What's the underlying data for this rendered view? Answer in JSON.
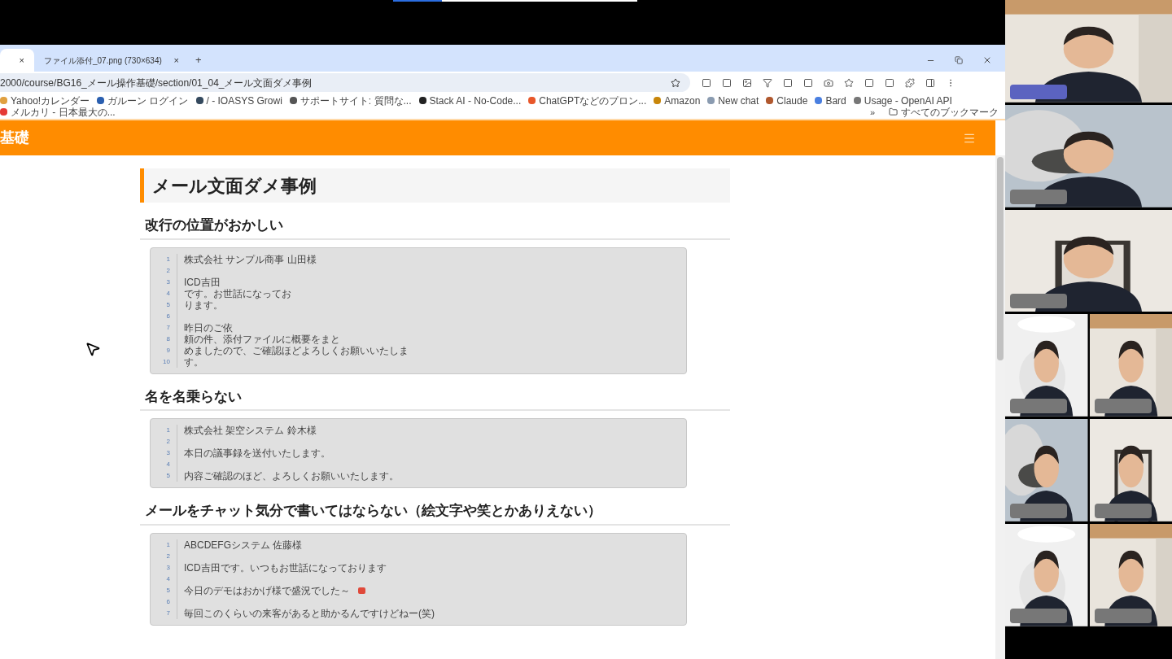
{
  "browser": {
    "tabs": [
      {
        "selected": true,
        "close": "×"
      },
      {
        "label": "ファイル添付_07.png (730×634)",
        "selected": false,
        "close": "×"
      }
    ],
    "new_tab": "+",
    "address": "2000/course/BG16_メール操作基礎/section/01_04_メール文面ダメ事例",
    "bookmarks": [
      {
        "label": "Yahoo!カレンダー",
        "color": "#e0a040"
      },
      {
        "label": "ガルーン ログイン",
        "color": "#2a5fb0"
      },
      {
        "label": "/ - IOASYS Growi",
        "color": "#34495e"
      },
      {
        "label": "サポートサイト: 質問な...",
        "color": "#555555"
      },
      {
        "label": "Stack AI - No-Code...",
        "color": "#222222"
      },
      {
        "label": "ChatGPTなどのプロン...",
        "color": "#e8572a"
      },
      {
        "label": "Amazon",
        "color": "#c8860a"
      },
      {
        "label": "New chat",
        "color": "#8a9bb0"
      },
      {
        "label": "Claude",
        "color": "#b0582e"
      },
      {
        "label": "Bard",
        "color": "#4a7fe0"
      },
      {
        "label": "Usage - OpenAI API",
        "color": "#777777"
      },
      {
        "label": "メルカリ - 日本最大の...",
        "color": "#e53935"
      }
    ],
    "more_bookmarks": "»",
    "all_bookmarks": "すべてのブックマーク"
  },
  "site": {
    "title": "基礎"
  },
  "article": {
    "title": "メール文面ダメ事例",
    "sections": [
      {
        "heading": "改行の位置がおかしい",
        "lines": [
          {
            "no": "1",
            "text": "株式会社 サンプル商事 山田様"
          },
          {
            "no": "2"
          },
          {
            "no": "3",
            "text": "ICD吉田"
          },
          {
            "no": "4",
            "text": "です。お世話になってお"
          },
          {
            "no": "5",
            "text": "ります。"
          },
          {
            "no": "6"
          },
          {
            "no": "7",
            "text": "昨日のご依"
          },
          {
            "no": "8",
            "text": "頼の件、添付ファイルに概要をまと"
          },
          {
            "no": "9",
            "text": "めましたので、ご確認ほどよろしくお願いいたしま"
          },
          {
            "no": "10",
            "text": "す。"
          }
        ]
      },
      {
        "heading": "名を名乗らない",
        "lines": [
          {
            "no": "1",
            "text": "株式会社 架空システム 鈴木様"
          },
          {
            "no": "2"
          },
          {
            "no": "3",
            "text": "本日の議事録を送付いたします。"
          },
          {
            "no": "4"
          },
          {
            "no": "5",
            "text": "内容ご確認のほど、よろしくお願いいたします。"
          }
        ]
      },
      {
        "heading": "メールをチャット気分で書いてはならない（絵文字や笑とかありえない）",
        "lines": [
          {
            "no": "1",
            "text": "ABCDEFGシステム 佐藤様"
          },
          {
            "no": "2"
          },
          {
            "no": "3",
            "text": "ICD吉田です。いつもお世話になっております"
          },
          {
            "no": "4"
          },
          {
            "no": "5",
            "text": "今日のデモはおかげ様で盛況でした～",
            "emoji": true
          },
          {
            "no": "6"
          },
          {
            "no": "7",
            "text": "毎回このくらいの来客があると助かるんですけどねー(笑)"
          }
        ]
      }
    ]
  },
  "participants": [
    {
      "kind": "picture",
      "highlighted": true
    },
    {
      "kind": "picture",
      "highlighted": false
    },
    {
      "kind": "picture",
      "highlighted": false
    },
    {
      "kind": "picture",
      "highlighted": false
    },
    {
      "kind": "picture",
      "highlighted": false
    },
    {
      "kind": "picture",
      "highlighted": false
    },
    {
      "kind": "picture",
      "highlighted": false
    },
    {
      "kind": "picture",
      "highlighted": false
    },
    {
      "kind": "picture",
      "highlighted": false
    }
  ]
}
